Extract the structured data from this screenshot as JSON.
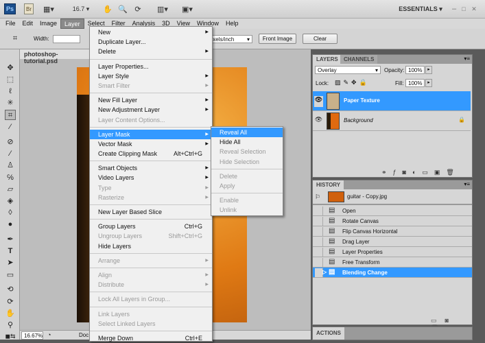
{
  "titlebar": {
    "zoom": "16.7",
    "workspace": "ESSENTIALS",
    "ps_logo": "Ps",
    "br_logo": "Br"
  },
  "menubar": [
    "File",
    "Edit",
    "Image",
    "Layer",
    "Select",
    "Filter",
    "Analysis",
    "3D",
    "View",
    "Window",
    "Help"
  ],
  "options": {
    "width_label": "Width:",
    "resolution_unit": "pixels/inch",
    "front_image": "Front Image",
    "clear": "Clear"
  },
  "document": {
    "tab": "photoshop-tutorial.psd",
    "zoom": "16.67%",
    "status": "Doc"
  },
  "layer_menu": [
    {
      "label": "New",
      "arrow": true
    },
    {
      "label": "Duplicate Layer..."
    },
    {
      "label": "Delete",
      "arrow": true
    },
    {
      "sep": true
    },
    {
      "label": "Layer Properties..."
    },
    {
      "label": "Layer Style",
      "arrow": true
    },
    {
      "label": "Smart Filter",
      "arrow": true,
      "disabled": true
    },
    {
      "sep": true
    },
    {
      "label": "New Fill Layer",
      "arrow": true
    },
    {
      "label": "New Adjustment Layer",
      "arrow": true
    },
    {
      "label": "Layer Content Options...",
      "disabled": true
    },
    {
      "sep": true
    },
    {
      "label": "Layer Mask",
      "arrow": true,
      "highlighted": true
    },
    {
      "label": "Vector Mask",
      "arrow": true
    },
    {
      "label": "Create Clipping Mask",
      "shortcut": "Alt+Ctrl+G"
    },
    {
      "sep": true
    },
    {
      "label": "Smart Objects",
      "arrow": true
    },
    {
      "label": "Video Layers",
      "arrow": true
    },
    {
      "label": "Type",
      "arrow": true,
      "disabled": true
    },
    {
      "label": "Rasterize",
      "arrow": true,
      "disabled": true
    },
    {
      "sep": true
    },
    {
      "label": "New Layer Based Slice"
    },
    {
      "sep": true
    },
    {
      "label": "Group Layers",
      "shortcut": "Ctrl+G"
    },
    {
      "label": "Ungroup Layers",
      "shortcut": "Shift+Ctrl+G",
      "disabled": true
    },
    {
      "label": "Hide Layers"
    },
    {
      "sep": true
    },
    {
      "label": "Arrange",
      "arrow": true,
      "disabled": true
    },
    {
      "sep": true
    },
    {
      "label": "Align",
      "arrow": true,
      "disabled": true
    },
    {
      "label": "Distribute",
      "arrow": true,
      "disabled": true
    },
    {
      "sep": true
    },
    {
      "label": "Lock All Layers in Group...",
      "disabled": true
    },
    {
      "sep": true
    },
    {
      "label": "Link Layers",
      "disabled": true
    },
    {
      "label": "Select Linked Layers",
      "disabled": true
    },
    {
      "sep": true
    },
    {
      "label": "Merge Down",
      "shortcut": "Ctrl+E"
    }
  ],
  "layer_mask_submenu": [
    {
      "label": "Reveal All",
      "highlighted": true
    },
    {
      "label": "Hide All"
    },
    {
      "label": "Reveal Selection",
      "disabled": true
    },
    {
      "label": "Hide Selection",
      "disabled": true
    },
    {
      "sep": true
    },
    {
      "label": "Delete",
      "disabled": true
    },
    {
      "label": "Apply",
      "disabled": true
    },
    {
      "sep": true
    },
    {
      "label": "Enable",
      "disabled": true
    },
    {
      "label": "Unlink",
      "disabled": true
    }
  ],
  "layers_panel": {
    "tabs": [
      "LAYERS",
      "CHANNELS"
    ],
    "blend_mode": "Overlay",
    "opacity_label": "Opacity:",
    "opacity": "100%",
    "lock_label": "Lock:",
    "fill_label": "Fill:",
    "fill": "100%",
    "layers": [
      {
        "name": "Paper Texture",
        "selected": true
      },
      {
        "name": "Background",
        "locked": true
      }
    ]
  },
  "history_panel": {
    "tab": "HISTORY",
    "snapshot": "guitar - Copy.jpg",
    "states": [
      "Open",
      "Rotate Canvas",
      "Flip Canvas Horizontal",
      "Drag Layer",
      "Layer Properties",
      "Free Transform",
      "Blending Change"
    ],
    "current": "Blending Change"
  },
  "actions_panel": {
    "tab": "ACTIONS"
  },
  "colors": {
    "highlight": "#3399ff"
  }
}
